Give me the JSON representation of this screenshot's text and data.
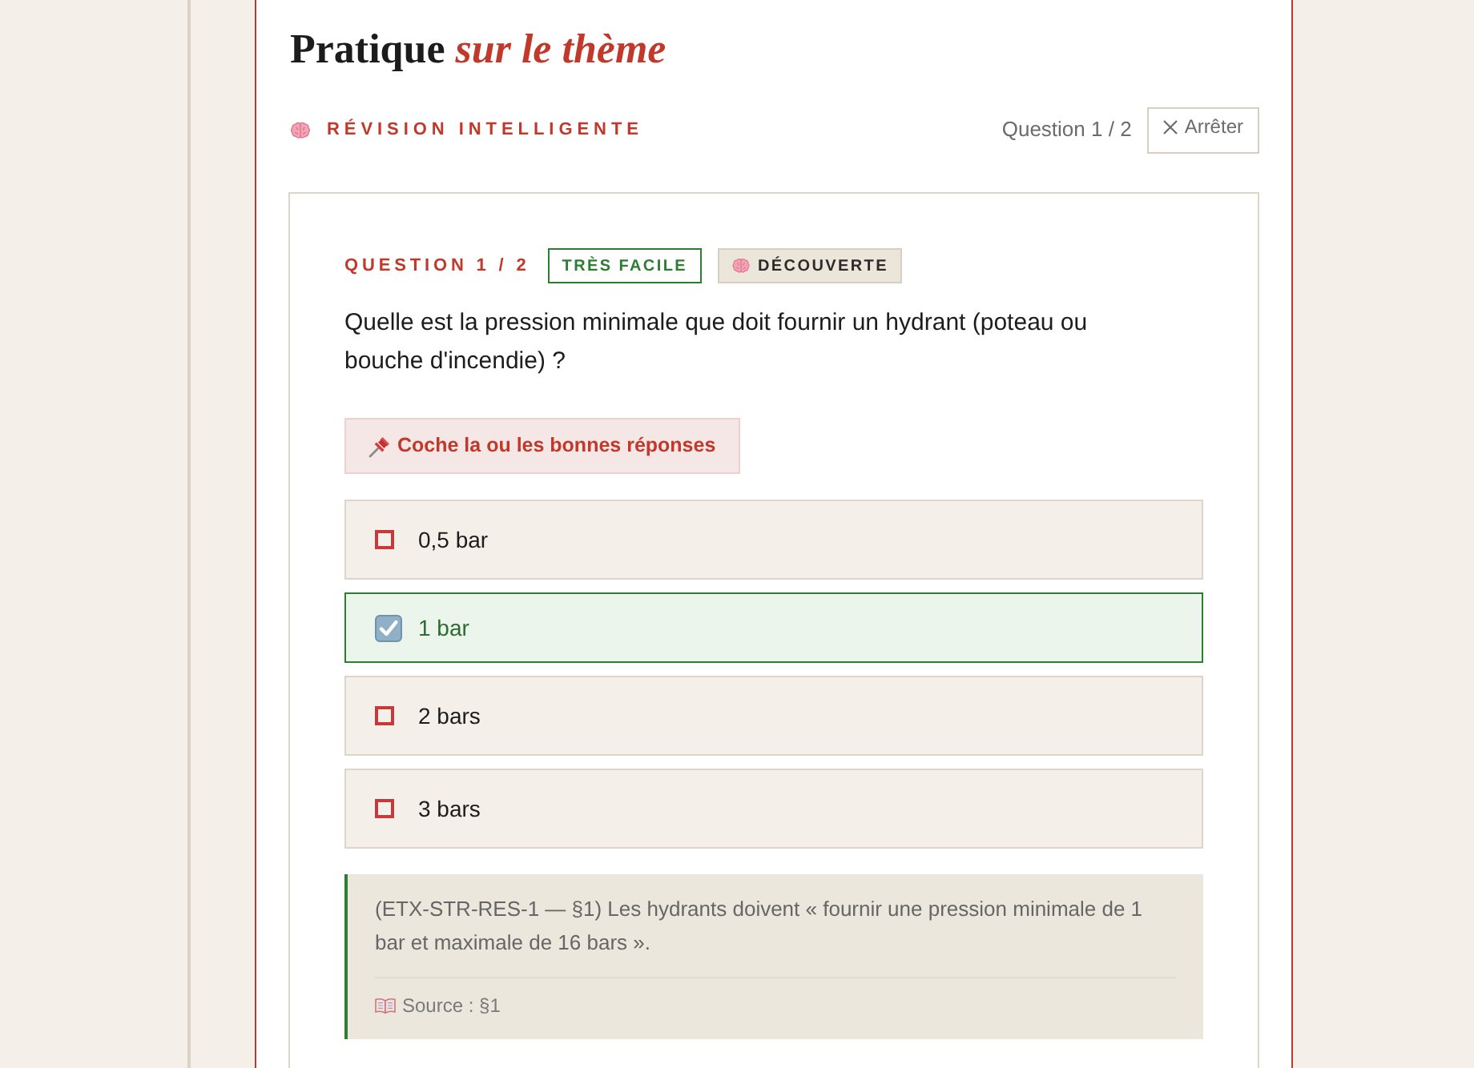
{
  "page": {
    "title": "Pratique *sur le thème*"
  },
  "header": {
    "mode_label": "RÉVISION INTELLIGENTE",
    "progress": "Question 1 / 2",
    "stop_button": "Arrêter"
  },
  "question": {
    "counter": "QUESTION 1 / 2",
    "badges": [
      {
        "kind": "difficulty",
        "label": "TRÈS FACILE"
      },
      {
        "kind": "mode",
        "label": "DÉCOUVERTE"
      }
    ],
    "text": "Quelle est la pression minimale que doit fournir un hydrant (poteau ou bouche d'incendie) ?",
    "instruction": "Coche la ou les bonnes réponses",
    "options": [
      {
        "label": "0,5 bar",
        "selected": false
      },
      {
        "label": "1 bar",
        "selected": true
      },
      {
        "label": "2 bars",
        "selected": false
      },
      {
        "label": "3 bars",
        "selected": false
      }
    ],
    "explanation": {
      "text": "(ETX-STR-RES-1 — §1) Les hydrants doivent « fournir une pression minimale de 1 bar et maximale de 16 bars ».",
      "source": "Source : §1"
    }
  }
}
